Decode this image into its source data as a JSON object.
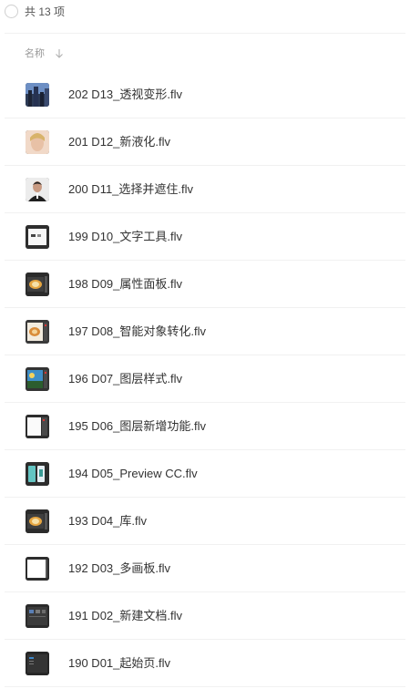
{
  "header": {
    "count_label": "共 13 项",
    "column_label": "名称",
    "sort_icon": "arrow-down-icon"
  },
  "files": [
    {
      "name": "202 D13_透视变形.flv",
      "thumb": "city"
    },
    {
      "name": "201 D12_新液化.flv",
      "thumb": "face"
    },
    {
      "name": "200 D11_选择并遮住.flv",
      "thumb": "portrait"
    },
    {
      "name": "199 D10_文字工具.flv",
      "thumb": "white-panel"
    },
    {
      "name": "198 D09_属性面板.flv",
      "thumb": "food-dark"
    },
    {
      "name": "197 D08_智能对象转化.flv",
      "thumb": "food-light"
    },
    {
      "name": "196 D07_图层样式.flv",
      "thumb": "sky"
    },
    {
      "name": "195 D06_图层新增功能.flv",
      "thumb": "white-app"
    },
    {
      "name": "194 D05_Preview CC.flv",
      "thumb": "phones"
    },
    {
      "name": "193 D04_库.flv",
      "thumb": "food-dark"
    },
    {
      "name": "192 D03_多画板.flv",
      "thumb": "white-board"
    },
    {
      "name": "191 D02_新建文档.flv",
      "thumb": "dark-doc"
    },
    {
      "name": "190 D01_起始页.flv",
      "thumb": "dark-start"
    }
  ]
}
